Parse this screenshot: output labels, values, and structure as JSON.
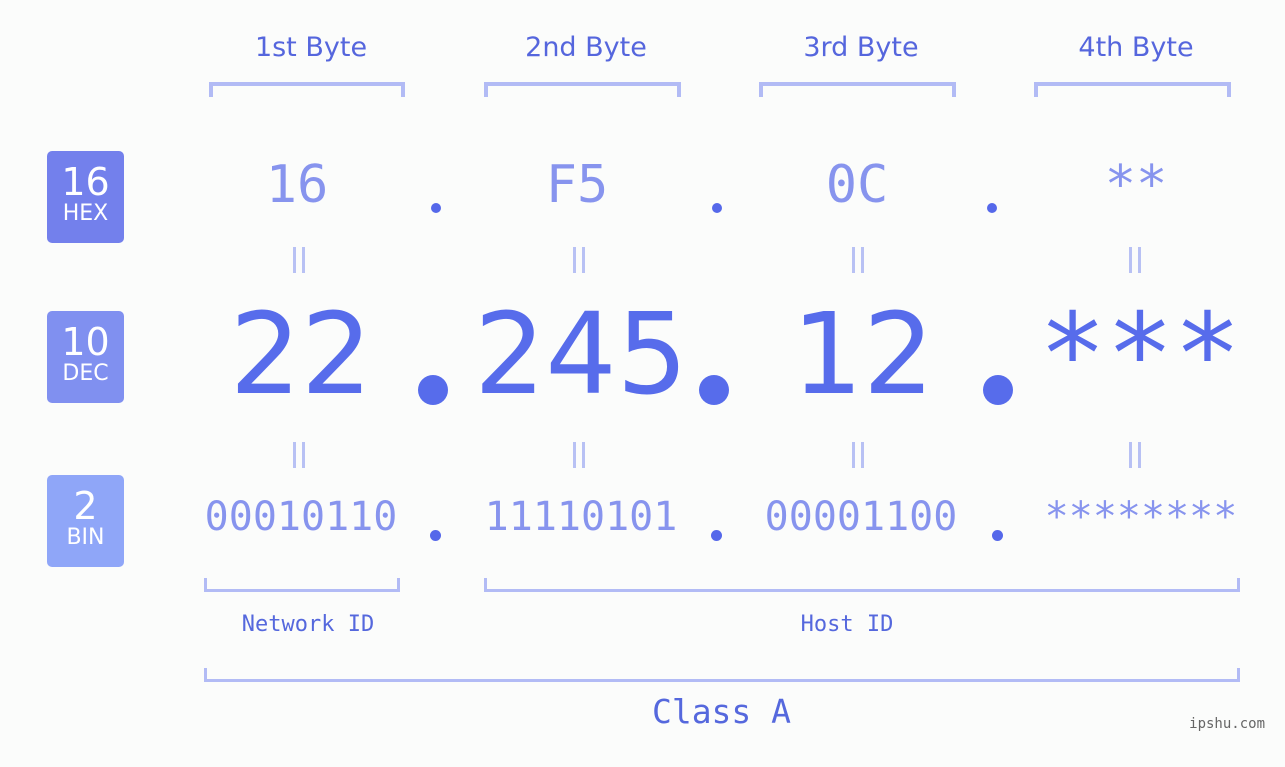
{
  "byte_headers": [
    "1st Byte",
    "2nd Byte",
    "3rd Byte",
    "4th Byte"
  ],
  "badges": {
    "hex": {
      "number": "16",
      "unit": "HEX",
      "color": "#7380ec"
    },
    "dec": {
      "number": "10",
      "unit": "DEC",
      "color": "#8090f0"
    },
    "bin": {
      "number": "2",
      "unit": "BIN",
      "color": "#8fa6f8"
    }
  },
  "hex": [
    "16",
    "F5",
    "0C",
    "**"
  ],
  "dec": [
    "22",
    "245",
    "12",
    "***"
  ],
  "bin": [
    "00010110",
    "11110101",
    "00001100",
    "********"
  ],
  "segments": {
    "network": "Network ID",
    "host": "Host ID"
  },
  "ip_class": "Class A",
  "watermark": "ipshu.com",
  "colors": {
    "accent": "#576ceb",
    "light_accent": "#8794ee",
    "bracket": "#b2bbf5",
    "background": "#fbfcfb"
  }
}
